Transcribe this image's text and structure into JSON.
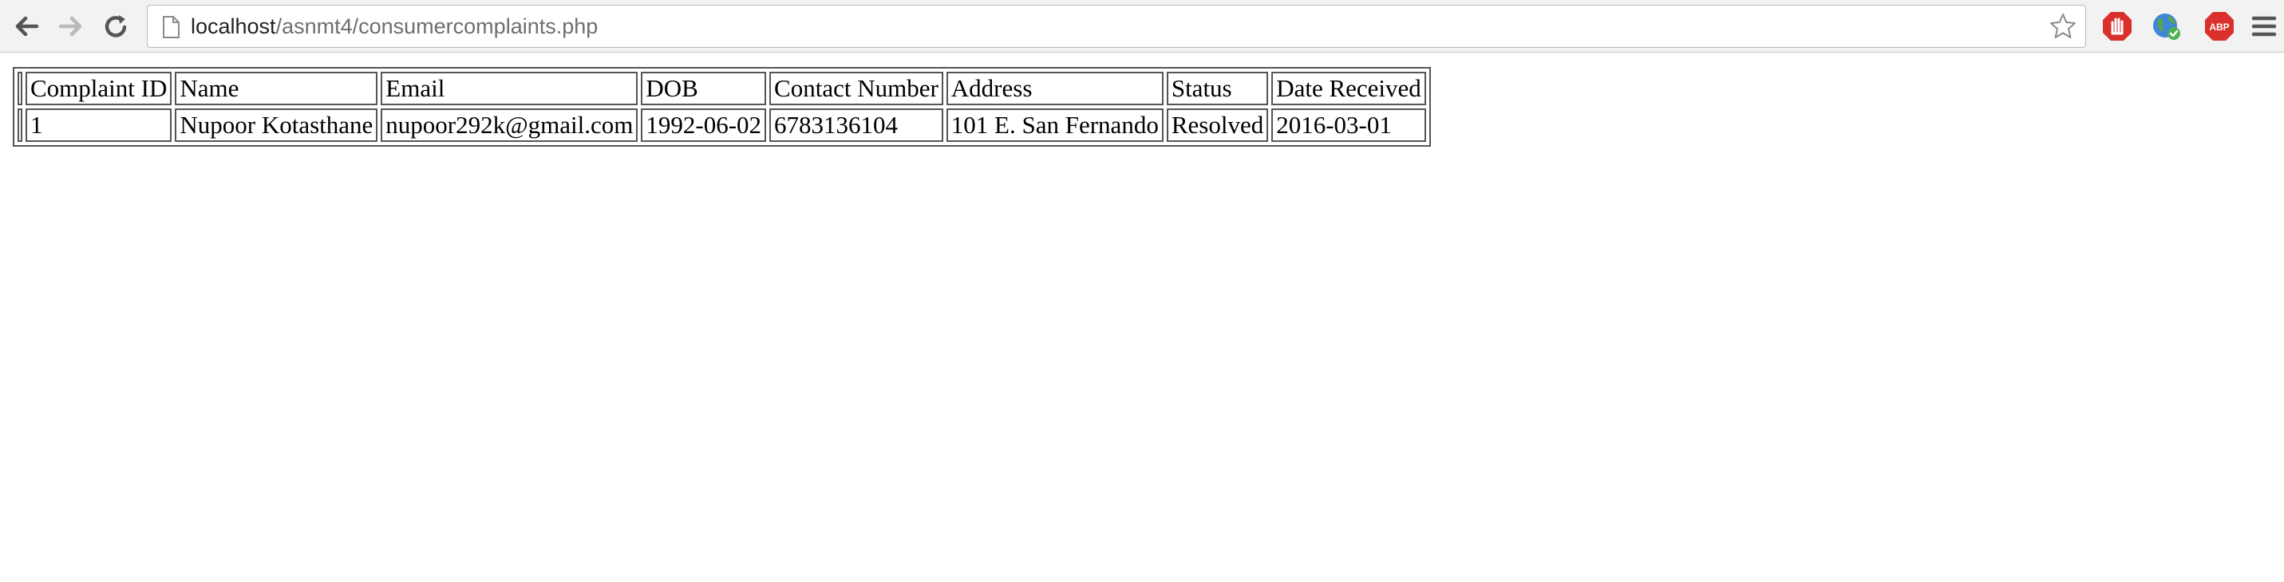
{
  "browser": {
    "url_host": "localhost",
    "url_path": "/asnmt4/consumercomplaints.php"
  },
  "table": {
    "headers": [
      "Complaint ID",
      "Name",
      "Email",
      "DOB",
      "Contact Number",
      "Address",
      "Status",
      "Date Received"
    ],
    "rows": [
      [
        "1",
        "Nupoor Kotasthane",
        "nupoor292k@gmail.com",
        "1992-06-02",
        "6783136104",
        "101 E. San Fernando",
        "Resolved",
        "2016-03-01"
      ]
    ]
  }
}
